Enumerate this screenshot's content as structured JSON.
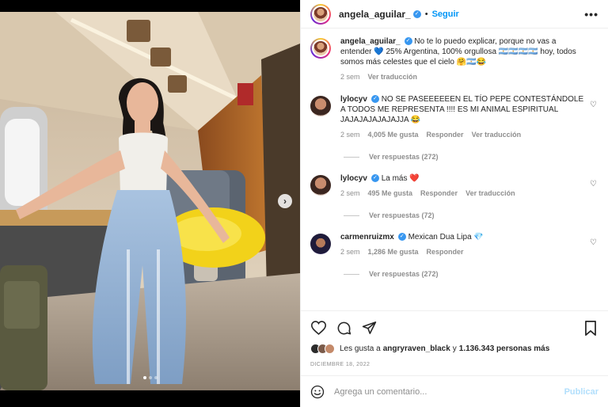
{
  "post": {
    "username": "angela_aguilar_",
    "follow_label": "Seguir",
    "separator": "•",
    "more_label": "•••"
  },
  "caption": {
    "username": "angela_aguilar_",
    "text": "No te lo puedo explicar, porque no vas a entender 💙 25% Argentina, 100% orgullosa 🇦🇷🇦🇷🇦🇷🇦🇷 hoy, todos somos más celestes que el cielo 🤗🇦🇷😂",
    "time": "2 sem",
    "translate_label": "Ver traducción"
  },
  "comments": [
    {
      "username": "lylocyv",
      "text": "NO SE PASEEEEEEN EL TÍO PEPE CONTESTÁNDOLE A TODOS ME REPRESENTA !!!! ES MI ANIMAL ESPIRITUAL JAJAJAJAJAJAJJA 😂",
      "time": "2 sem",
      "likes": "4,005 Me gusta",
      "reply_label": "Responder",
      "translate_label": "Ver traducción",
      "replies_label": "Ver respuestas (272)"
    },
    {
      "username": "lylocyv",
      "text": "La más ❤️",
      "time": "2 sem",
      "likes": "495 Me gusta",
      "reply_label": "Responder",
      "translate_label": "Ver traducción",
      "replies_label": "Ver respuestas (72)"
    },
    {
      "username": "carmenruizmx",
      "text": "Mexican Dua Lipa 💎",
      "time": "2 sem",
      "likes": "1,286 Me gusta",
      "reply_label": "Responder",
      "replies_label": "Ver respuestas (272)"
    }
  ],
  "likes": {
    "prefix": "Les gusta a",
    "user": "angryraven_black",
    "connector": "y",
    "count": "1.136.343 personas más"
  },
  "date": "DICIEMBRE 18, 2022",
  "comment_box": {
    "placeholder": "Agrega un comentario...",
    "publish_label": "Publicar"
  },
  "carousel": {
    "next_icon": "›",
    "dots": 3,
    "active": 0
  }
}
